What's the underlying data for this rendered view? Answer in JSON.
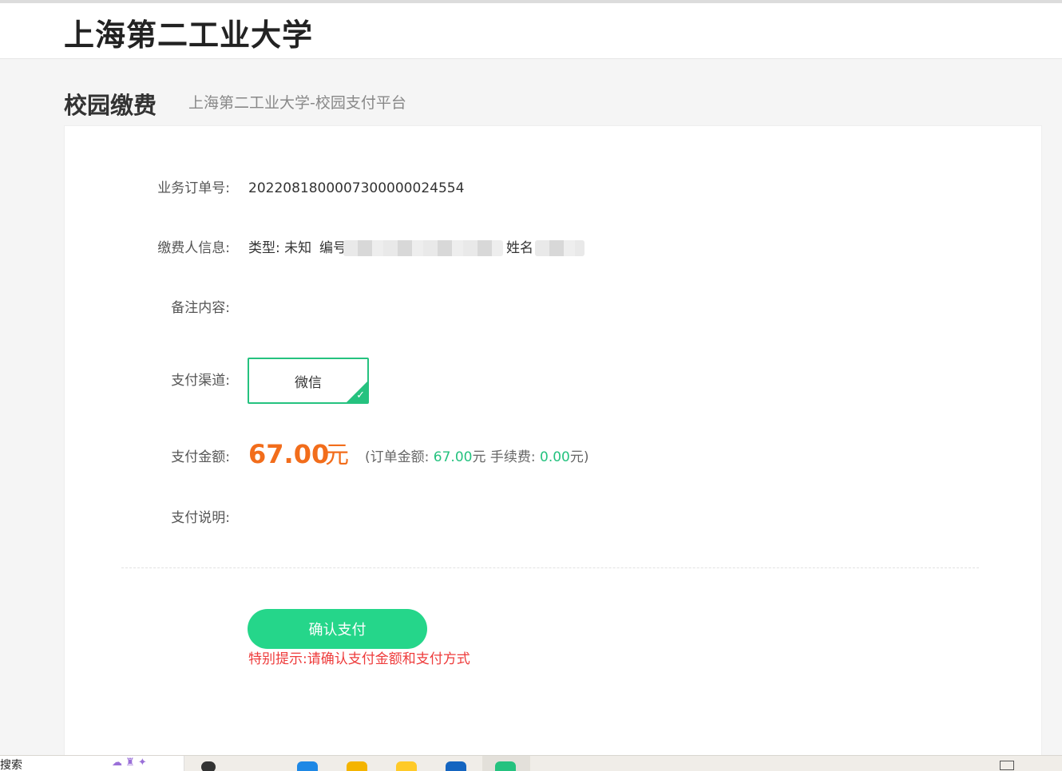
{
  "header": {
    "university": "上海第二工业大学"
  },
  "section": {
    "title": "校园缴费",
    "subtitle": "上海第二工业大学-校园支付平台"
  },
  "order": {
    "number_label": "业务订单号:",
    "number": "2022081800007300000024554",
    "payer_label": "缴费人信息:",
    "payer_type": "类型: 未知",
    "payer_id_label": "编号",
    "payer_name_label": "姓名",
    "remark_label": "备注内容:",
    "channel_label": "支付渠道:",
    "channel": "微信",
    "amount_label": "支付金额:",
    "amount": "67.00",
    "amount_unit": "元",
    "order_amount_label": "(订单金额:",
    "order_amount": "67.00",
    "order_amount_unit": "元",
    "fee_label": "手续费:",
    "fee": "0.00",
    "fee_unit": "元)",
    "description_label": "支付说明:"
  },
  "actions": {
    "confirm": "确认支付",
    "tip": "特别提示:请确认支付金额和支付方式"
  },
  "taskbar": {
    "search_text": "搜索"
  },
  "colors": {
    "accent": "#25c27f",
    "amount": "#f26d1b",
    "warning": "#ee3b3b"
  }
}
